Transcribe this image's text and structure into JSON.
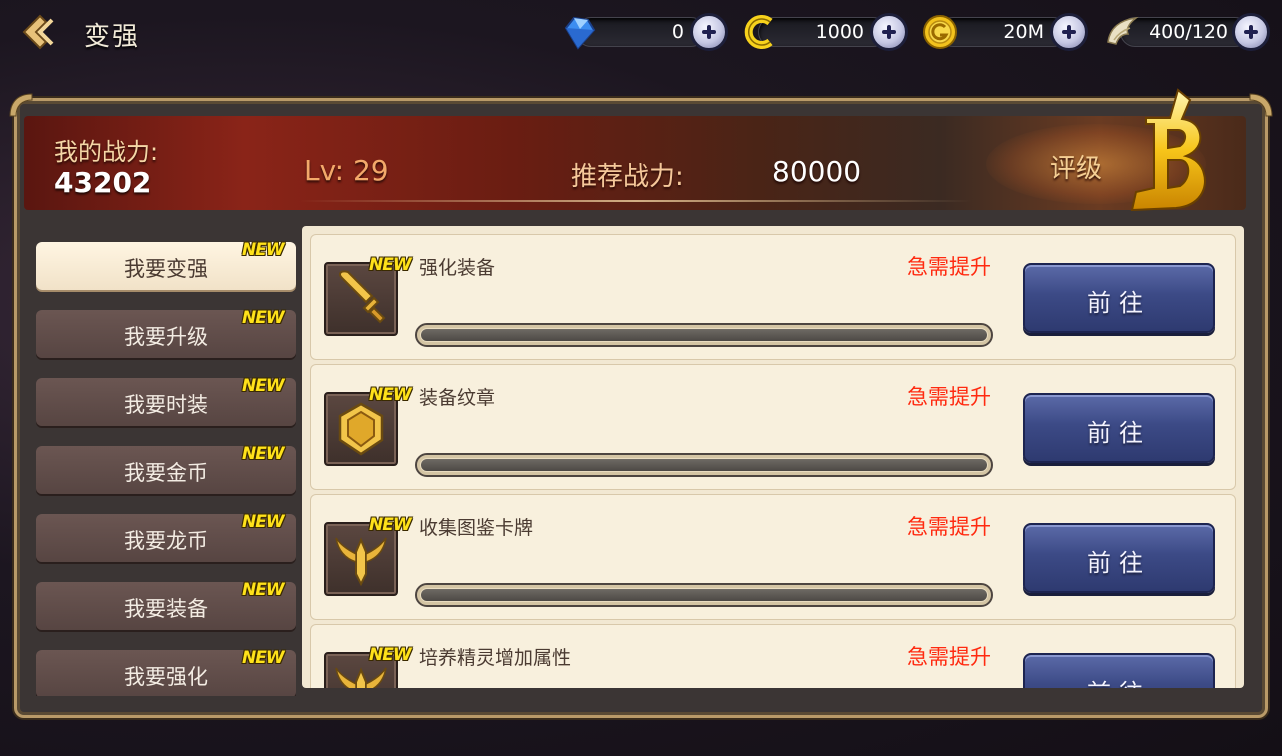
{
  "header": {
    "title": "变强",
    "back_icon": "back-arrow-icon"
  },
  "currencies": [
    {
      "name": "diamond",
      "icon": "diamond-icon",
      "value": "0"
    },
    {
      "name": "coupon",
      "icon": "c-coin-icon",
      "value": "1000"
    },
    {
      "name": "gold",
      "icon": "gold-coin-icon",
      "value": "20M"
    },
    {
      "name": "stamina",
      "icon": "wing-icon",
      "value": "400/120"
    }
  ],
  "banner": {
    "power_label": "我的战力:",
    "power_value": "43202",
    "level": "Lv: 29",
    "recommended_label": "推荐战力:",
    "recommended_value": "80000",
    "grade_label": "评级",
    "grade": "B"
  },
  "sidebar": {
    "new_tag": "NEW",
    "items": [
      {
        "label": "我要变强",
        "active": true
      },
      {
        "label": "我要升级",
        "active": false
      },
      {
        "label": "我要时装",
        "active": false
      },
      {
        "label": "我要金币",
        "active": false
      },
      {
        "label": "我要龙币",
        "active": false
      },
      {
        "label": "我要装备",
        "active": false
      },
      {
        "label": "我要强化",
        "active": false
      }
    ]
  },
  "list": {
    "new_tag": "NEW",
    "go_label": "前往",
    "items": [
      {
        "title": "强化装备",
        "status": "急需提升",
        "icon": "sword-icon"
      },
      {
        "title": "装备纹章",
        "status": "急需提升",
        "icon": "shield-icon"
      },
      {
        "title": "收集图鉴卡牌",
        "status": "急需提升",
        "icon": "winged-emblem-icon"
      },
      {
        "title": "培养精灵增加属性",
        "status": "急需提升",
        "icon": "winged-emblem-icon"
      }
    ]
  },
  "colors": {
    "status_red": "#ff2a10",
    "new_yellow": "#ffe21a",
    "button_blue": "#3c4a86",
    "frame_gold": "#b99a68"
  }
}
